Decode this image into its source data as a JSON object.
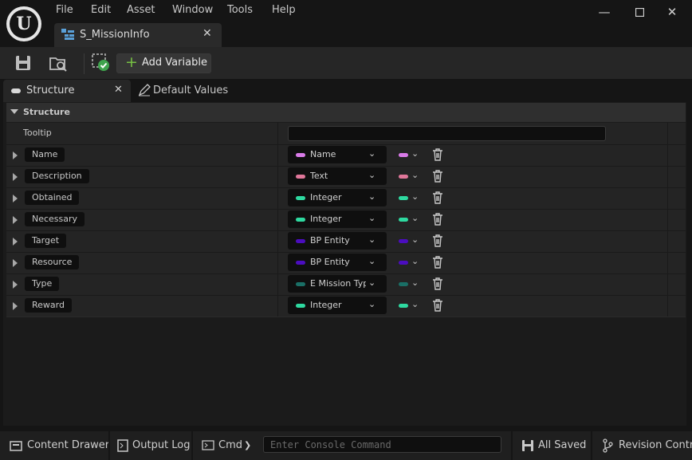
{
  "menu": [
    "File",
    "Edit",
    "Asset",
    "Window",
    "Tools",
    "Help"
  ],
  "document_tab": {
    "label": "S_MissionInfo"
  },
  "toolbar": {
    "add_variable": "Add Variable"
  },
  "panel_tabs": {
    "structure": "Structure",
    "defaults": "Default Values"
  },
  "section": {
    "title": "Structure"
  },
  "tooltip": {
    "label": "Tooltip",
    "value": ""
  },
  "variables": [
    {
      "name": "Name",
      "type": "Name",
      "color": "#d97be8"
    },
    {
      "name": "Description",
      "type": "Text",
      "color": "#e0779a"
    },
    {
      "name": "Obtained",
      "type": "Integer",
      "color": "#2ed9a0"
    },
    {
      "name": "Necessary",
      "type": "Integer",
      "color": "#2ed9a0"
    },
    {
      "name": "Target",
      "type": "BP Entity",
      "color": "#4b0dbf"
    },
    {
      "name": "Resource",
      "type": "BP Entity",
      "color": "#4b0dbf"
    },
    {
      "name": "Type",
      "type": "E Mission Type",
      "color": "#1a6f66"
    },
    {
      "name": "Reward",
      "type": "Integer",
      "color": "#2ed9a0"
    }
  ],
  "statusbar": {
    "content_drawer": "Content Drawer",
    "output_log": "Output Log",
    "cmd": "Cmd",
    "console_placeholder": "Enter Console Command",
    "all_saved": "All Saved",
    "revision_control": "Revision Control"
  },
  "colors": {
    "accent_green": "#76c043",
    "background": "#151515",
    "panel": "#242424"
  }
}
